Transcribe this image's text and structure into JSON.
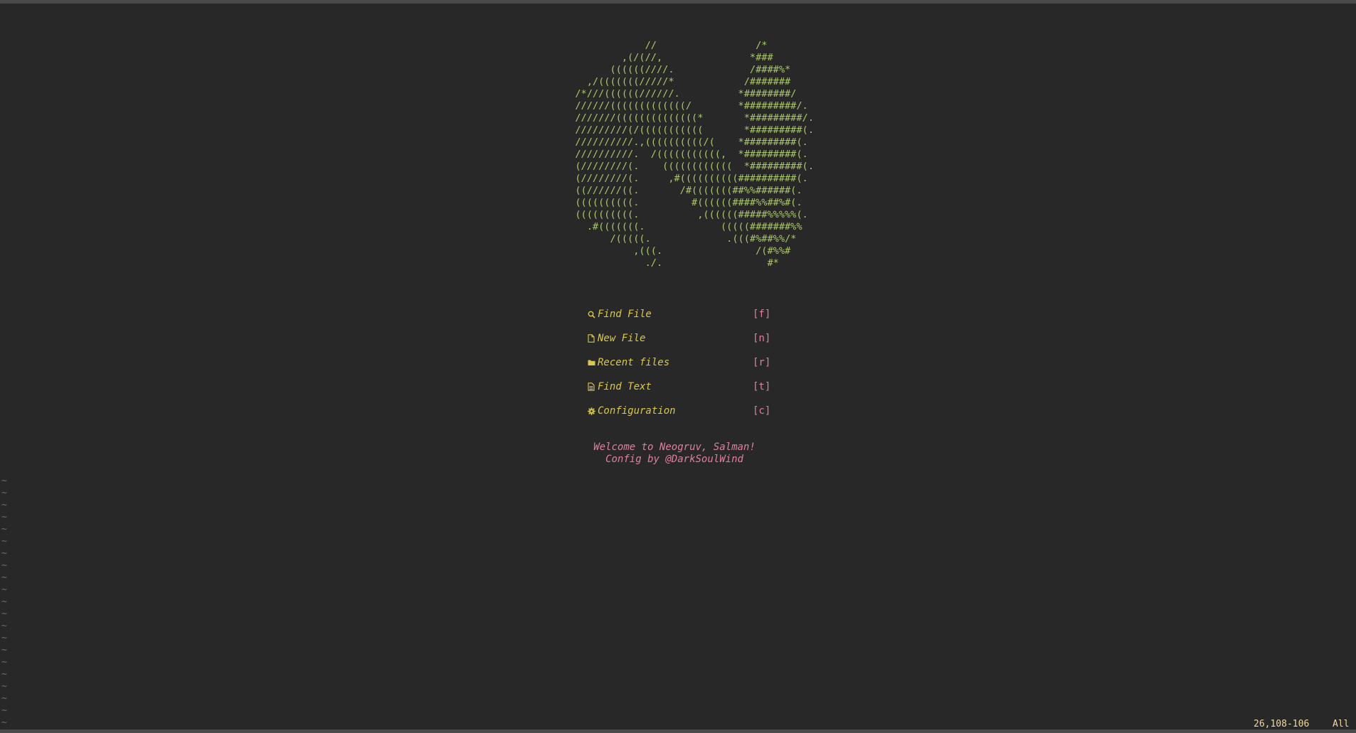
{
  "dashboard": {
    "logo_ascii": "              //                 /*\n          ,(/(//,               *###\n        ((((((////.             /####%*\n    ,/(((((((/////*            /#######\n  /*///((((((//////.          *########/\n  //////(((((((((((((/        *#########/.\n  ///////((((((((((((((*       *#########/.\n  /////////(/(((((((((((       *#########(.\n  //////////.,((((((((((/(    *#########(.\n  //////////.  /(((((((((((,  *#########(.\n  (////////(.    ((((((((((((  *#########(.\n  (////////(.     ,#((((((((((##########(.\n  ((//////((.       /#(((((((##%%######(.\n  ((((((((((.         #((((((####%%##%#(.\n  ((((((((((.          ,((((((#####%%%%%(.\n    .#(((((((.             (((((#######%%\n        /(((((.             .(((#%##%%/*\n            ,(((.                /(#%%#\n              ./.                  #*",
    "menu": [
      {
        "icon": "search-icon",
        "label": "Find File",
        "key": "[f]"
      },
      {
        "icon": "file-icon",
        "label": "New File",
        "key": "[n]"
      },
      {
        "icon": "folder-icon",
        "label": "Recent files",
        "key": "[r]"
      },
      {
        "icon": "text-file-icon",
        "label": "Find Text",
        "key": "[t]"
      },
      {
        "icon": "gear-icon",
        "label": "Configuration",
        "key": "[c]"
      }
    ],
    "footer_line1": "Welcome to Neogruv, Salman!",
    "footer_line2": "Config by @DarkSoulWind"
  },
  "buffer": {
    "tildes": "~\n~\n~\n~\n~\n~\n~\n~\n~\n~\n~\n~\n~\n~\n~\n~\n~\n~\n~\n~\n~"
  },
  "statusline": {
    "position": "26,108-106",
    "scroll": "All"
  },
  "colors": {
    "background": "#282828",
    "logo": "#a9c769",
    "menu_label": "#d8c84a",
    "menu_key": "#e07fa4",
    "footer": "#e07fa4",
    "tilde": "#6e6e6e",
    "status": "#f0d9a3"
  }
}
